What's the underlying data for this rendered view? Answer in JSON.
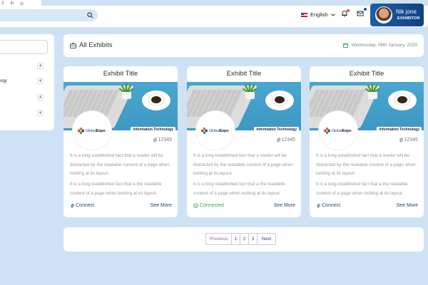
{
  "header": {
    "language": "English",
    "user": {
      "name": "Nik jone",
      "role": "EXHIBITOR"
    }
  },
  "filter": {
    "categories": [
      {
        "label": "",
        "count": "4"
      },
      {
        "label": "ogy",
        "count": "4"
      },
      {
        "label": "",
        "count": "4"
      },
      {
        "label": "",
        "count": "4"
      }
    ]
  },
  "exhibits": {
    "title": "All Exhibits",
    "date": "Wednesday, 08th January, 2020"
  },
  "cards": [
    {
      "title": "Exhibit Title",
      "tag": "Information Technology",
      "attachments": "12345",
      "logo_left": "Global",
      "logo_right": "Expo",
      "desc1": "It is a long established fact that a reader will be distracted by the readable content of a page when looking at its layout.",
      "desc2": "It is a long established fact that a the readable content of a page when looking at its layout.",
      "connect": "Connect",
      "more": "See More"
    },
    {
      "title": "Exhibit Title",
      "tag": "Information Technology",
      "attachments": "12345",
      "logo_left": "Global",
      "logo_right": "Expo",
      "desc1": "It is a long established fact that a reader will be distracted by the readable content of a page when looking at its layout.",
      "desc2": "It is a long established fact that a the readable content of a page when looking at its layout.",
      "connect": "Connected",
      "more": "See More"
    },
    {
      "title": "Exhibit Title",
      "tag": "Information Technology",
      "attachments": "12345",
      "logo_left": "Global",
      "logo_right": "Expo",
      "desc1": "It is a long established fact that a reader will be distracted by the readable content of a page when looking at its layout.",
      "desc2": "It is a long established fact that a the readable content of a page when looking at its layout.",
      "connect": "Connect",
      "more": "See More"
    }
  ],
  "pagination": {
    "previous": "Previous",
    "pages": [
      "1",
      "2",
      "3"
    ],
    "next": "Next"
  },
  "colors": {
    "background": "#cfe2f5",
    "user_badge": "#1a4f9c",
    "connected": "#2eaa4a",
    "link": "#23466e"
  }
}
